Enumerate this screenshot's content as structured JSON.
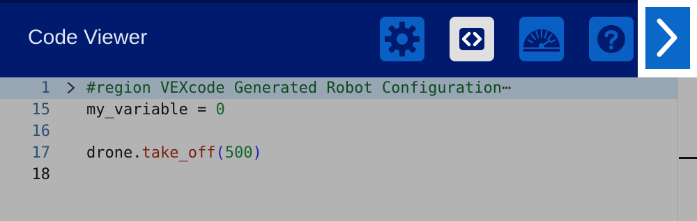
{
  "header": {
    "title": "Code Viewer",
    "buttons": [
      {
        "name": "settings",
        "icon": "gear-icon",
        "active": false
      },
      {
        "name": "code",
        "icon": "code-brackets-icon",
        "active": true
      },
      {
        "name": "dashboard",
        "icon": "gauge-icon",
        "active": false
      },
      {
        "name": "help",
        "icon": "question-icon",
        "active": false
      }
    ],
    "next_icon": "chevron-right-icon"
  },
  "editor": {
    "lines": [
      {
        "number": "1",
        "text": "#region VEXcode Generated Robot Configuration",
        "folded": true,
        "ellipsis": "⋯"
      },
      {
        "number": "15",
        "text": "my_variable = 0"
      },
      {
        "number": "16",
        "text": ""
      },
      {
        "number": "17",
        "text": "drone.take_off(500)"
      },
      {
        "number": "18",
        "text": ""
      }
    ]
  },
  "colors": {
    "header_bg": "#001a6e",
    "button_bg": "#0a5fc4",
    "active_button_bg": "#e0e0e0",
    "editor_bg": "#b3b3b3",
    "current_line_bg": "#98a6b3"
  }
}
